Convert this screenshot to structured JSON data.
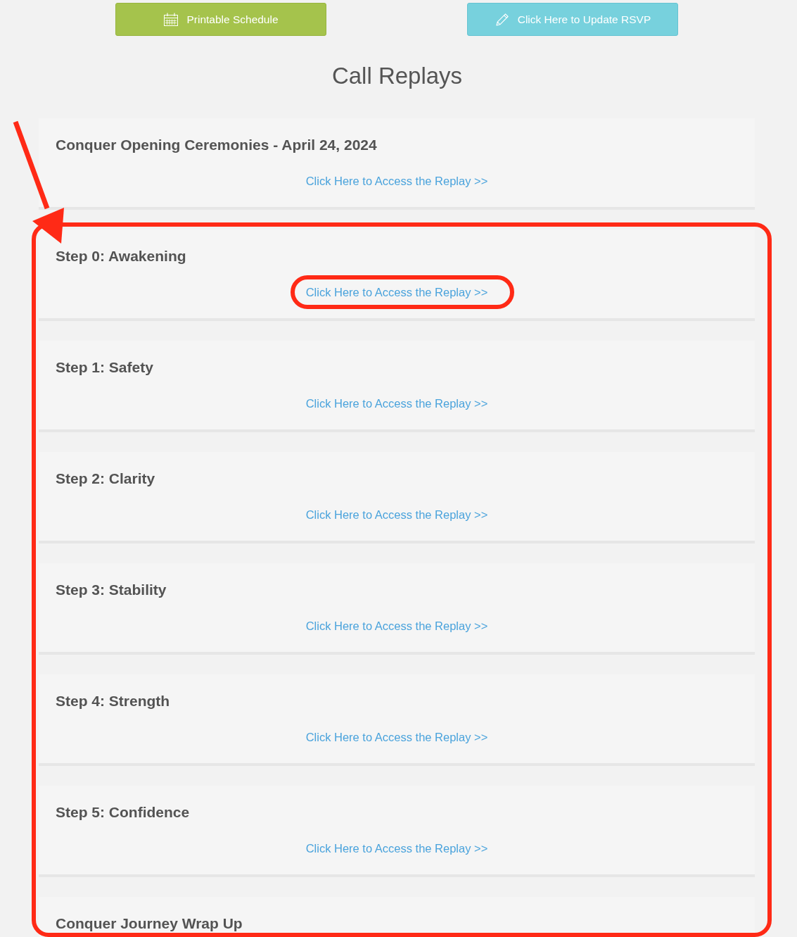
{
  "buttons": [
    {
      "kind": "schedule",
      "label": "Printable Schedule"
    },
    {
      "kind": "rsvp",
      "label": "Click Here to Update RSVP"
    }
  ],
  "heading": "Call Replays",
  "replays": [
    {
      "title": "Conquer Opening Ceremonies - April 24, 2024",
      "link": {
        "text": "Click Here to Access the Replay >>",
        "circled": false
      }
    }
  ],
  "highlight_frame": {
    "replays": [
      {
        "title": "Step 0: Awakening",
        "link": {
          "text": "Click Here to Access the Replay >>",
          "circled": true
        }
      },
      {
        "title": "Step 1: Safety",
        "link": {
          "text": "Click Here to Access the Replay >>",
          "circled": false
        }
      },
      {
        "title": "Step 2: Clarity",
        "link": {
          "text": "Click Here to Access the Replay >>",
          "circled": false
        }
      },
      {
        "title": "Step 3: Stability",
        "link": {
          "text": "Click Here to Access the Replay >>",
          "circled": false
        }
      },
      {
        "title": "Step 4: Strength",
        "link": {
          "text": "Click Here to Access the Replay >>",
          "circled": false
        }
      },
      {
        "title": "Step 5: Confidence",
        "link": {
          "text": "Click Here to Access the Replay >>",
          "circled": false
        }
      },
      {
        "title": "Conquer Journey Wrap Up"
      }
    ]
  }
}
